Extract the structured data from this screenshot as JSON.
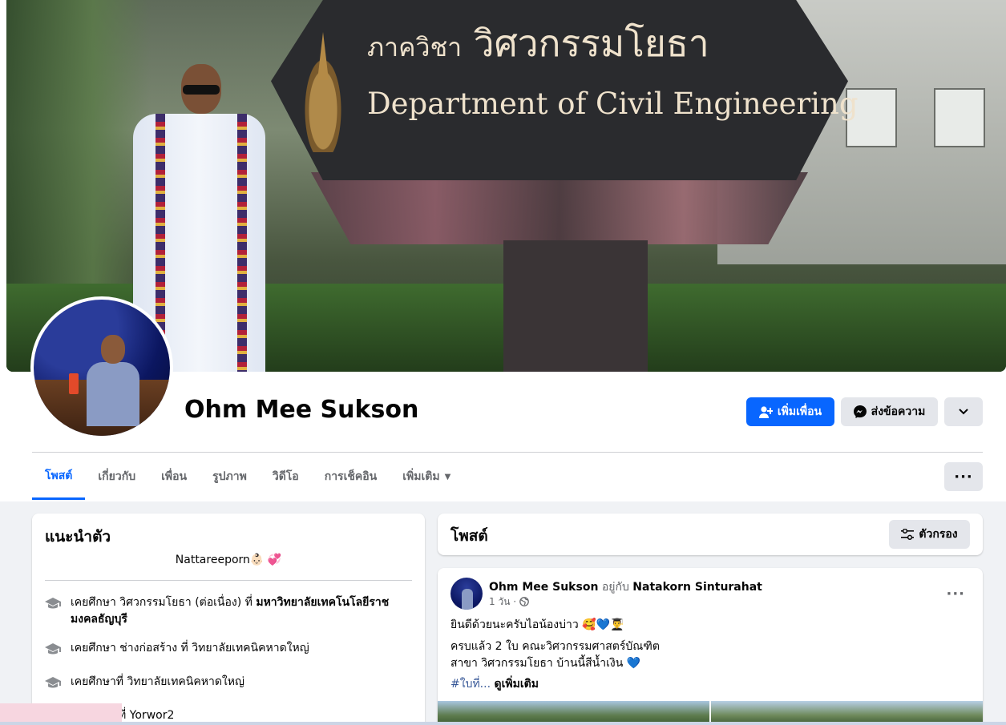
{
  "cover": {
    "sign_thai_small": "ภาควิชา",
    "sign_thai_big": "วิศวกรรมโยธา",
    "sign_english": "Department of Civil Engineering"
  },
  "profile": {
    "name": "Ohm Mee Sukson"
  },
  "actions": {
    "add_friend": "เพิ่มเพื่อน",
    "message": "ส่งข้อความ"
  },
  "tabs": [
    {
      "label": "โพสต์",
      "active": true
    },
    {
      "label": "เกี่ยวกับ"
    },
    {
      "label": "เพื่อน"
    },
    {
      "label": "รูปภาพ"
    },
    {
      "label": "วิดีโอ"
    },
    {
      "label": "การเช็คอิน"
    },
    {
      "label": "เพิ่มเติม"
    }
  ],
  "intro": {
    "title": "แนะนำตัว",
    "bio": "Nattareeporn👶🏻 💞",
    "items": [
      {
        "prefix": "เคยศึกษา วิศวกรรมโยธา (ต่อเนื่อง) ที่ ",
        "bold": "มหาวิทยาลัยเทคโนโลยีราช",
        "bold2": "มงคลธัญบุรี"
      },
      {
        "prefix": "เคยศึกษา ช่างก่อสร้าง ที่ วิทยาลัยเทคนิคหาดใหญ่"
      },
      {
        "prefix": "เคยศึกษาที่ วิทยาลัยเทคนิคหาดใหญ่"
      },
      {
        "prefix": "ที่ Yorwor2"
      }
    ]
  },
  "posts_section": {
    "title": "โพสต์",
    "filter": "ตัวกรอง"
  },
  "post": {
    "author": "Ohm Mee Sukson",
    "with_word": "อยู่กับ",
    "tagged": "Natakorn Sinturahat",
    "time": "1 วัน ·",
    "line1": "ยินดีด้วยนะครับไอน้องบ่าว 🥰💙👨‍🎓",
    "line2": "ครบแล้ว 2 ใบ คณะวิศวกรรมศาสตร์บัณฑิต",
    "line3": "สาขา วิศวกรรมโยธา บ้านนี้สีน้ำเงิน 💙",
    "tag": "#ใบที่...",
    "see_more": "ดูเพิ่มเติม"
  },
  "colors": {
    "primary": "#0866ff",
    "secondary_button": "#e4e6eb",
    "page_bg": "#f0f2f5",
    "muted_text": "#65676b"
  }
}
